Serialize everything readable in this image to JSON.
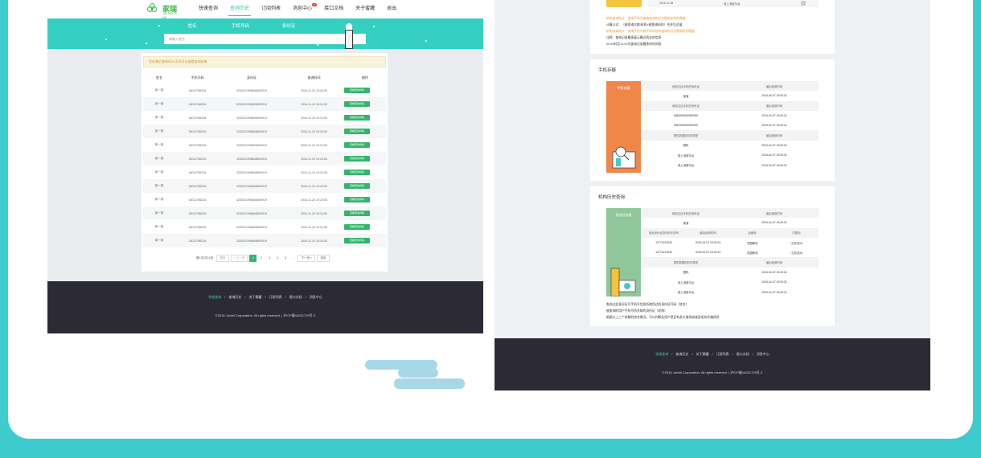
{
  "colors": {
    "accent": "#35cfc1",
    "button": "#35b46a",
    "orange": "#f0874a",
    "green_illus": "#8fc79a",
    "yellow": "#f6c33d",
    "footer": "#2c2b35"
  },
  "left": {
    "logo": {
      "name": "家瑞",
      "sub": "JIA REI JI KE",
      "icon": "logo-icon"
    },
    "nav": [
      {
        "label": "快速查询",
        "active": false
      },
      {
        "label": "查询历史",
        "active": true
      },
      {
        "label": "订阅列表",
        "active": false
      },
      {
        "label": "消息中心",
        "active": false,
        "badge": "6"
      },
      {
        "label": "接口文档",
        "active": false
      },
      {
        "label": "关于蜜罐",
        "active": false
      },
      {
        "label": "退出",
        "active": false
      }
    ],
    "banner_tabs": [
      "姓名",
      "手机号码",
      "身份证"
    ],
    "search_placeholder": "请输入姓名",
    "notice": "您在最近查询的30天内可以查看查询结果",
    "table": {
      "headers": [
        "姓名",
        "手机号码",
        "身份证",
        "查询时间",
        "操作"
      ],
      "rows": [
        [
          "某一某",
          "18012786234",
          "3205221998848893919",
          "2016-11-24 19:24:53",
          "查看查询详情"
        ],
        [
          "某一某",
          "18012786234",
          "3205221998848893919",
          "2016-11-24 19:24:53",
          "查看查询详情"
        ],
        [
          "某一某",
          "18012786234",
          "3205221998848893919",
          "2016-11-24 19:24:53",
          "查看查询详情"
        ],
        [
          "某一某",
          "18012786234",
          "3205221998848893919",
          "2016-11-24 19:24:53",
          "查看查询详情"
        ],
        [
          "某一某",
          "18012786234",
          "3205221998848893919",
          "2016-11-24 19:24:53",
          "查看查询详情"
        ],
        [
          "某一某",
          "18012786234",
          "3205221998848893919",
          "2016-11-24 19:24:53",
          "查看查询详情"
        ],
        [
          "某一某",
          "18012786234",
          "3205221998848893919",
          "2016-11-24 19:24:53",
          "查看查询详情"
        ],
        [
          "某一某",
          "18012786234",
          "3205221998848893919",
          "2016-11-24 19:24:53",
          "查看查询详情"
        ],
        [
          "某一某",
          "18012786234",
          "3205221998848893919",
          "2016-11-24 19:24:53",
          "查看查询详情"
        ],
        [
          "某一某",
          "18012786234",
          "3205221998848893919",
          "2016-11-24 19:24:53",
          "查看查询详情"
        ],
        [
          "某一某",
          "18012786234",
          "3205221998848893919",
          "2016-11-24 19:24:53",
          "查看查询详情"
        ],
        [
          "某一某",
          "18012786234",
          "3205221998848893919",
          "2016-11-24 19:24:53",
          "查看查询详情"
        ]
      ]
    },
    "pager": {
      "summary": "第1页/共10页",
      "first": "首页",
      "prev": "< 上一页",
      "pages": [
        "1",
        "2",
        "3",
        "4",
        "5",
        "..."
      ],
      "current": "1",
      "next": "下一页 >",
      "last": "末页"
    },
    "footer": {
      "links": [
        "快速查询",
        "查询历史",
        "关于蜜罐",
        "订阅列表",
        "接口文档",
        "消息中心"
      ],
      "copyright": "©2016 Juxinli Corporation. All rights reserved.  |  沪ICP备14021729号-3"
    }
  },
  "right": {
    "top_row": {
      "date": "2015-11-38",
      "value": "线上消费平台"
    },
    "notes": [
      {
        "text": "机构查询统计：查询手机号被被查询的总次数和机构的数量",
        "orange": true
      },
      {
        "text": "计算公式：（被查询次数/机构×被查询机构）合并后总量",
        "orange": false
      },
      {
        "text": "机构查询统计：查询手机号被不同的机构查询的总次数和机构数量",
        "orange": true
      },
      {
        "text": "注释：查询记录最多展示最近两年的信息",
        "orange": false
      },
      {
        "text": "00:00时至14:00为查询记录最多的时间段",
        "orange": false
      }
    ],
    "phone_section": {
      "title": "手机存疑",
      "label": "手机存疑",
      "rows": [
        {
          "type": "h",
          "cells": [
            "使用过此手机的身份证",
            "最后使用时间"
          ]
        },
        {
          "type": "d",
          "cells": [
            "某某",
            "2015-04-07 15:00:31"
          ]
        },
        {
          "type": "h",
          "cells": [
            "使用过此手机的身份证",
            "最后使用时间"
          ]
        },
        {
          "type": "d",
          "cells": [
            "0682935962509250",
            "2015-04-07 15:00:31"
          ]
        },
        {
          "type": "d",
          "cells": [
            "0682935962509250",
            "2015-04-07 15:00:31"
          ]
        },
        {
          "type": "h",
          "cells": [
            "提供数据的机构类型",
            "最后使用时间"
          ]
        },
        {
          "type": "d",
          "cells": [
            "银机",
            "2015-04-07 15:00:31"
          ]
        },
        {
          "type": "d",
          "cells": [
            "线上消费平台",
            "2015-04-07 15:00:31"
          ]
        },
        {
          "type": "d",
          "cells": [
            "线上消费平台",
            "2015-04-07 15:00:31"
          ]
        }
      ]
    },
    "history_section": {
      "title": "机构历史查询",
      "label": "身份证存疑",
      "rows": [
        {
          "type": "h",
          "cells": [
            "使用过此手机的身份证",
            "最后使用时间"
          ]
        },
        {
          "type": "d",
          "cells": [
            "某某",
            "2015-04-07 15:00:31"
          ]
        },
        {
          "type": "h4",
          "cells": [
            "用此身份证查询的手机号",
            "最后使用时间",
            "运营商",
            "归属地"
          ]
        },
        {
          "type": "d4",
          "cells": [
            "13771212040",
            "2015-04-07 15:00:31",
            "中国移动",
            "江苏/苏州"
          ]
        },
        {
          "type": "d4",
          "cells": [
            "13771212040",
            "2015-04-07 15:00:31",
            "中国移动",
            "江苏/苏州"
          ]
        },
        {
          "type": "h",
          "cells": [
            "提供数据的机构类型",
            "最后使用时间"
          ]
        },
        {
          "type": "d",
          "cells": [
            "银机",
            "2015-04-07 15:00:31"
          ]
        },
        {
          "type": "d",
          "cells": [
            "线上消费平台",
            "2015-04-07 15:00:31"
          ]
        },
        {
          "type": "d",
          "cells": [
            "线上消费平台",
            "2015-04-07 15:00:31"
          ]
        }
      ],
      "summary": [
        "查询过此身份证号手机号信息所使用过的身份证号码（姓名）",
        "被查询的用户手机号所关联的身份证（机构）",
        "根据以上三个参数的综合情况，可以判断此用户是否有多头借贷或者身份有诈骗风险"
      ]
    },
    "footer": {
      "links": [
        "快速查询",
        "查询历史",
        "关于蜜罐",
        "订阅列表",
        "接口文档",
        "消息中心"
      ],
      "copyright": "©2016 Juxinli Corporation. All rights reserved.  |  沪ICP备14021729号-3"
    }
  }
}
